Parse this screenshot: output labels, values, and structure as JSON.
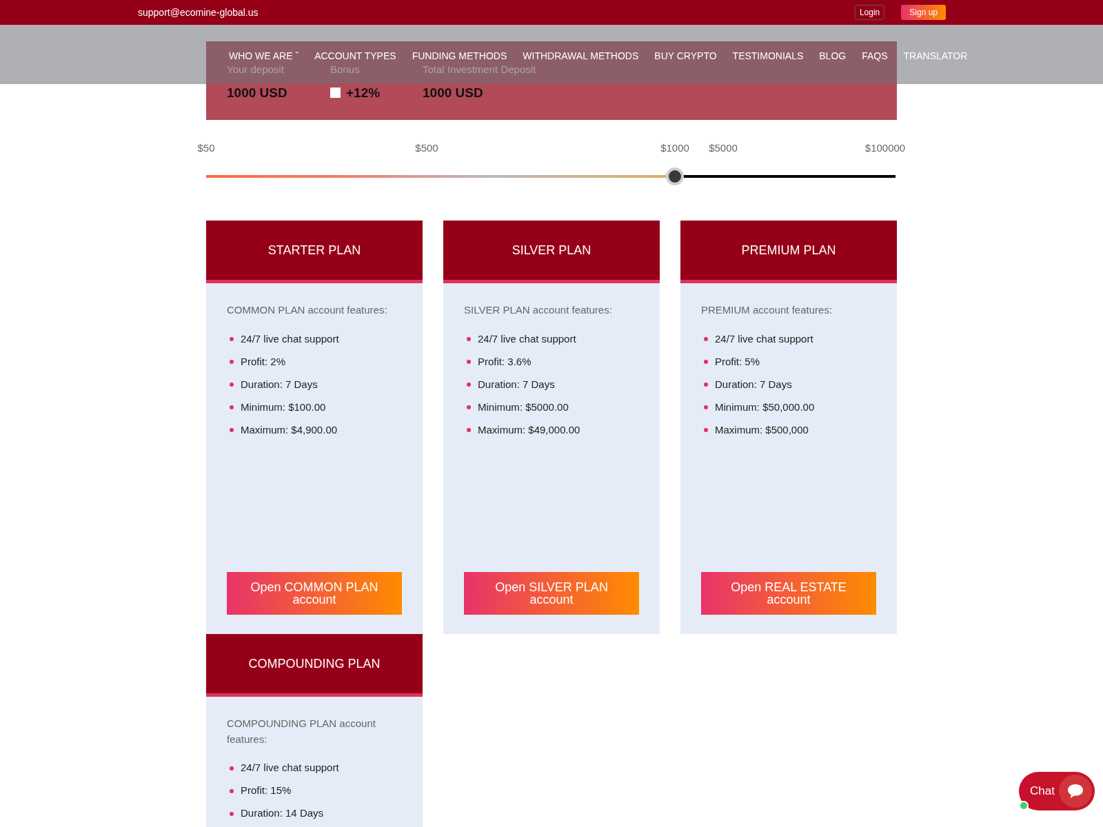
{
  "topbar": {
    "email": "support@ecomine-global.us",
    "login": "Login",
    "signup": "Sign up"
  },
  "nav": [
    {
      "label": "WHO WE ARE",
      "caret": "ˇ"
    },
    {
      "label": "ACCOUNT TYPES"
    },
    {
      "label": "FUNDING METHODS"
    },
    {
      "label": "WITHDRAWAL METHODS"
    },
    {
      "label": "BUY CRYPTO"
    },
    {
      "label": "TESTIMONIALS"
    },
    {
      "label": "BLOG"
    },
    {
      "label": "FAQS"
    },
    {
      "label": "TRANSLATOR"
    }
  ],
  "summary": [
    {
      "label": "Your deposit",
      "value": "1000 USD"
    },
    {
      "label": "Bonus",
      "value": "+12%",
      "checked": false
    },
    {
      "label": "Total Investment Deposit",
      "value": "1000 USD"
    }
  ],
  "slider": {
    "level": 0.68,
    "ticks": [
      "$50",
      "$500",
      "$1000",
      "$5000",
      "$100000"
    ]
  },
  "plans": [
    {
      "title": "STARTER PLAN",
      "intro": "COMMON PLAN account features:",
      "features": [
        "24/7 live chat support",
        "Profit: 2%",
        "Duration: 7 Days",
        "Minimum: $100.00",
        "Maximum: $4,900.00"
      ],
      "button": "Open COMMON PLAN account"
    },
    {
      "title": "SILVER PLAN",
      "intro": "SILVER PLAN account features:",
      "features": [
        "24/7 live chat support",
        "Profit: 3.6%",
        "Duration: 7 Days",
        "Minimum: $5000.00",
        "Maximum: $49,000.00"
      ],
      "button": "Open SILVER PLAN account"
    },
    {
      "title": "PREMIUM PLAN",
      "intro": "PREMIUM account features:",
      "features": [
        "24/7 live chat support",
        "Profit: 5%",
        "Duration: 7 Days",
        "Minimum: $50,000.00",
        "Maximum: $500,000"
      ],
      "button": "Open REAL ESTATE account"
    },
    {
      "title": "COMPOUNDING PLAN",
      "intro": "COMPOUNDING PLAN account features:",
      "features": [
        "24/7 live chat support",
        "Profit: 15%",
        "Duration: 14 Days"
      ]
    }
  ],
  "chat": {
    "label": "Chat",
    "online": true
  }
}
